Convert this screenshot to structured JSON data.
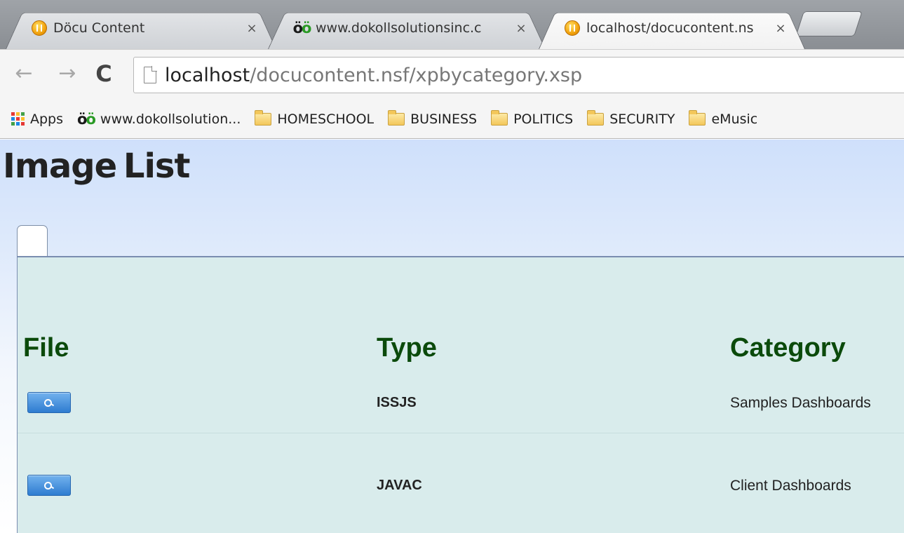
{
  "browser": {
    "tabs": [
      {
        "title": "Döcu Content",
        "icon": "orange-globe-favicon",
        "active": false
      },
      {
        "title": "www.dokollsolutionsinc.c",
        "icon": "oo-favicon",
        "active": false
      },
      {
        "title": "localhost/docucontent.ns",
        "icon": "orange-globe-favicon",
        "active": true
      }
    ],
    "close_glyph": "×",
    "nav": {
      "back": "←",
      "forward": "→",
      "reload": "C"
    },
    "url": {
      "host": "localhost",
      "path": "/docucontent.nsf/xpbycategory.xsp"
    },
    "bookmarks": {
      "apps": "Apps",
      "site": {
        "logo": "öö",
        "label": "www.dokollsolution..."
      },
      "folders": [
        "HOMESCHOOL",
        "BUSINESS",
        "POLITICS",
        "SECURITY",
        "eMusic"
      ]
    }
  },
  "page": {
    "title": "Image List",
    "table": {
      "headers": {
        "file": "File",
        "type": "Type",
        "category": "Category"
      },
      "rows": [
        {
          "type": "ISSJS",
          "category": "Samples Dashboards"
        },
        {
          "type": "JAVAC",
          "category": "Client Dashboards"
        }
      ]
    }
  },
  "colors": {
    "header_text": "#0b4a0b",
    "panel_bg": "#d9ecec",
    "page_bg_top": "#cfe0fb",
    "button_blue": "#2e7cd0"
  }
}
